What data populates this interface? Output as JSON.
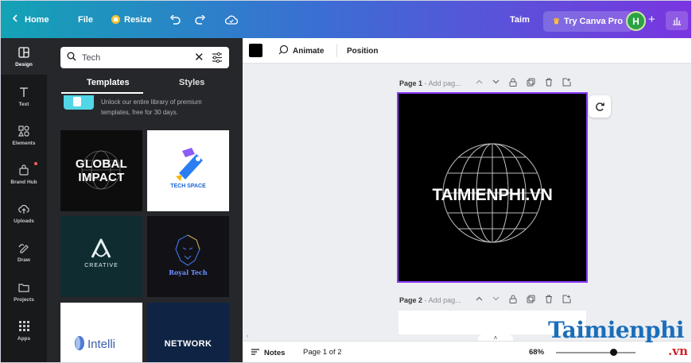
{
  "topbar": {
    "home": "Home",
    "file": "File",
    "resize": "Resize",
    "user_name": "Taim",
    "try_pro": "Try Canva Pro",
    "avatar_initial": "H"
  },
  "rail": {
    "items": [
      {
        "label": "Design",
        "icon": "layout-icon"
      },
      {
        "label": "Text",
        "icon": "text-icon"
      },
      {
        "label": "Elements",
        "icon": "shapes-icon"
      },
      {
        "label": "Brand Hub",
        "icon": "brand-icon"
      },
      {
        "label": "Uploads",
        "icon": "upload-icon"
      },
      {
        "label": "Draw",
        "icon": "draw-icon"
      },
      {
        "label": "Projects",
        "icon": "folder-icon"
      },
      {
        "label": "Apps",
        "icon": "apps-icon"
      }
    ]
  },
  "panel": {
    "search_value": "Tech",
    "tabs": [
      "Templates",
      "Styles"
    ],
    "promo": "Unlock our entire library of premium templates, free for 30 days.",
    "templates": [
      {
        "title": "GLOBAL IMPACT"
      },
      {
        "title": "TECH SPACE"
      },
      {
        "title": "CREATIVE"
      },
      {
        "title": "Royal Tech"
      },
      {
        "title": "Intelli"
      },
      {
        "title": "NETWORK"
      }
    ]
  },
  "toolbar": {
    "animate": "Animate",
    "position": "Position"
  },
  "pages": [
    {
      "label": "Page 1",
      "placeholder": "Add pag..."
    },
    {
      "label": "Page 2",
      "placeholder": "Add pag..."
    }
  ],
  "canvas": {
    "brand_text": "TAIMIENPHI.VN"
  },
  "bottombar": {
    "notes": "Notes",
    "page_count": "Page 1 of 2",
    "zoom": "68%"
  },
  "watermark": {
    "text": "Taimienphi",
    "suffix": ".vn"
  },
  "colors": {
    "accent": "#8b3dff",
    "rail_bg": "#18191b",
    "panel_bg": "#25272b"
  }
}
